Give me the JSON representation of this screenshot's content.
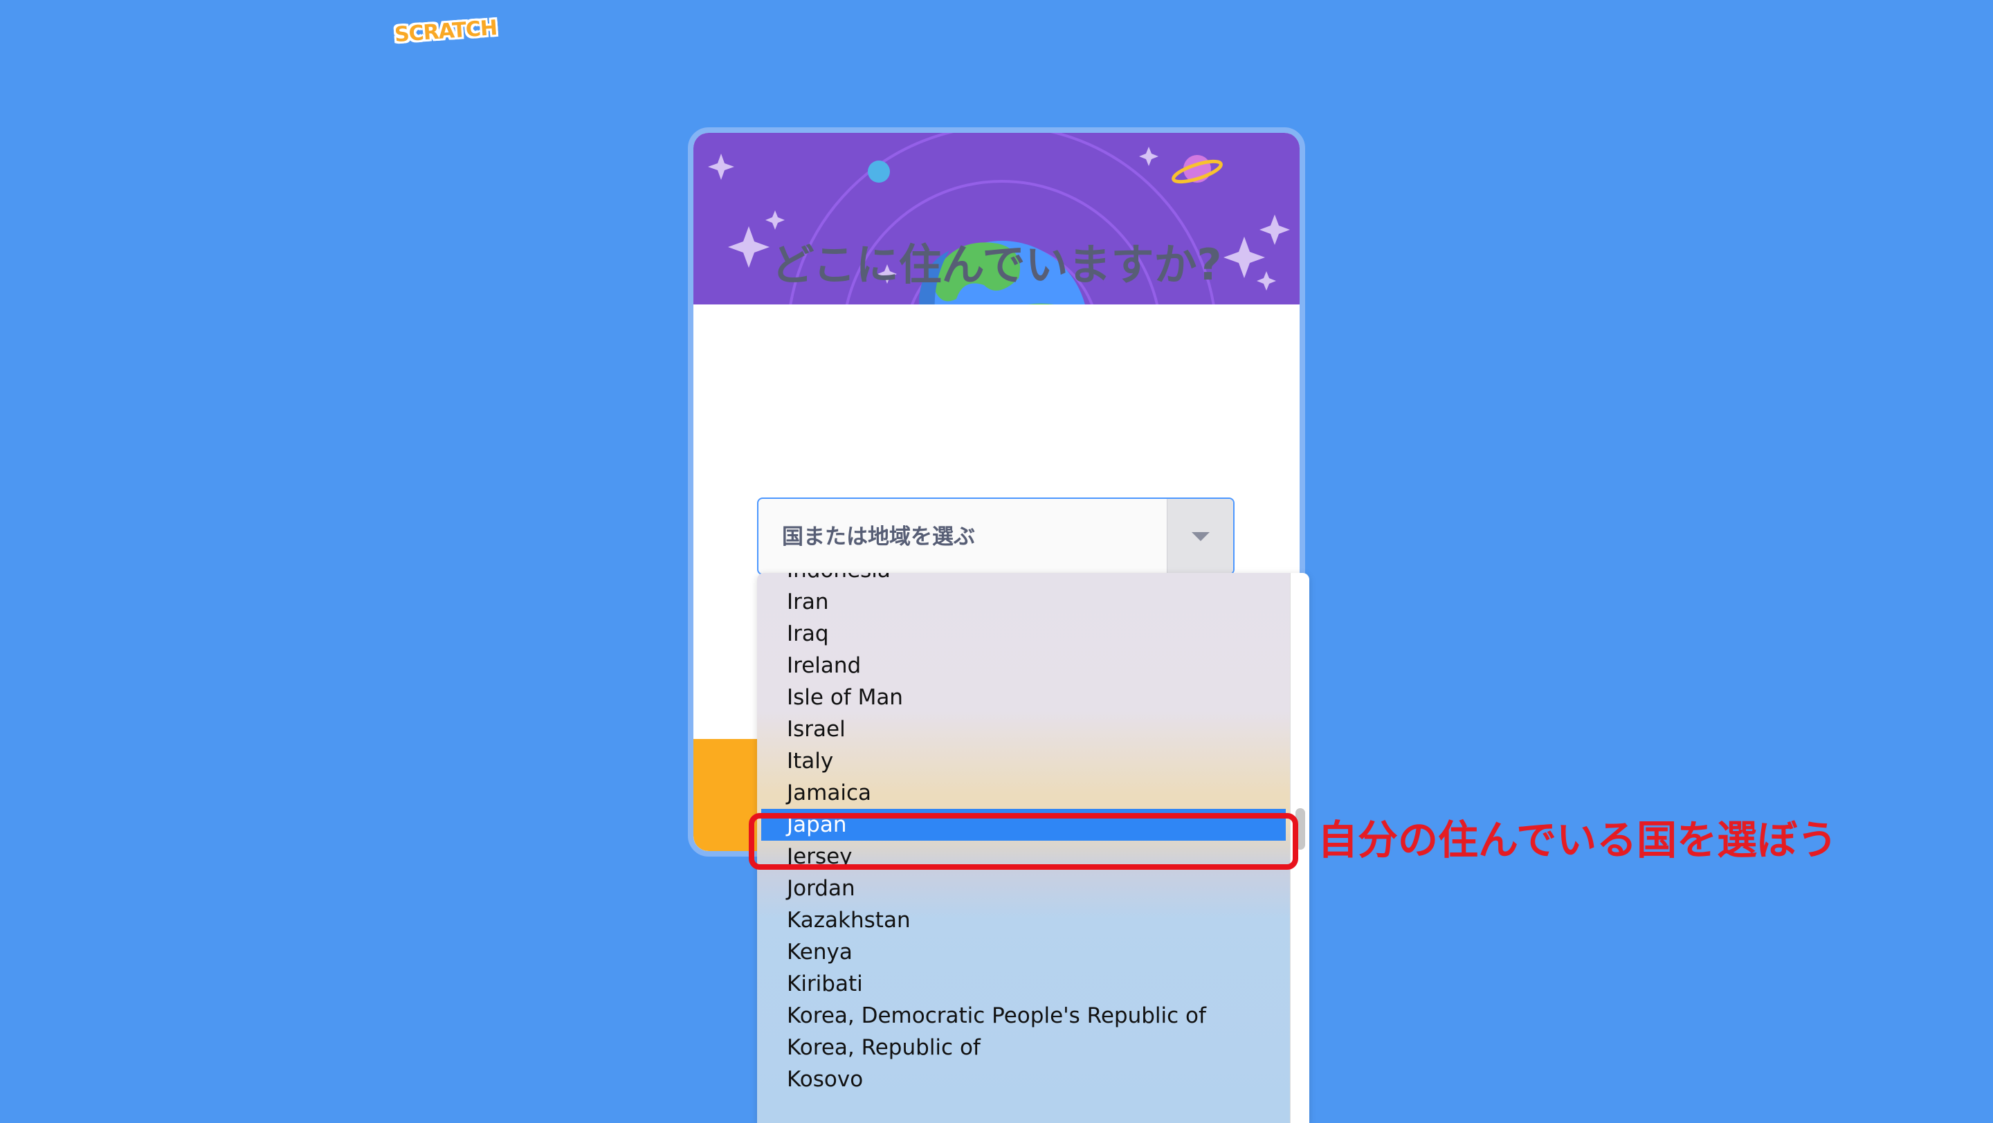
{
  "header": {
    "logo_text": "SCRATCH"
  },
  "modal": {
    "question": "どこに住んでいますか?",
    "select": {
      "placeholder": "国または地域を選ぶ"
    },
    "dropdown": {
      "options": [
        "Indonesia",
        "Iran",
        "Iraq",
        "Ireland",
        "Isle of Man",
        "Israel",
        "Italy",
        "Jamaica",
        "Japan",
        "Jersey",
        "Jordan",
        "Kazakhstan",
        "Kenya",
        "Kiribati",
        "Korea, Democratic People's Republic of",
        "Korea, Republic of",
        "Kosovo"
      ],
      "selected": "Japan"
    }
  },
  "annotation": {
    "text": "自分の住んでいる国を選ぼう"
  },
  "colors": {
    "background": "#4d97f2",
    "banner": "#7b4fcf",
    "footer": "#fbab1f",
    "selected_option": "#2f86f5",
    "annotation": "#e51c23",
    "question_text": "#575e75"
  }
}
